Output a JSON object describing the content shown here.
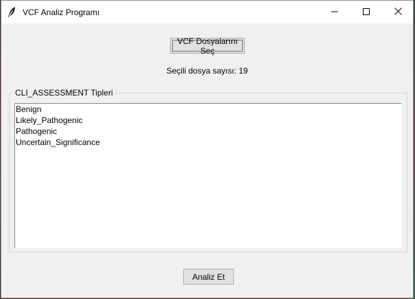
{
  "window": {
    "title": "VCF Analiz Programı",
    "icon": "feather-icon",
    "controls": {
      "minimize_icon": "minimize-icon",
      "maximize_icon": "maximize-icon",
      "close_icon": "close-icon"
    }
  },
  "file_select": {
    "button_label": "VCF Dosyalarını Seç",
    "count_label": "Seçili dosya sayısı: 19"
  },
  "assessment_group": {
    "title": "CLI_ASSESSMENT Tipleri",
    "items": [
      "Benign",
      "Likely_Pathogenic",
      "Pathogenic",
      "Uncertain_Significance"
    ]
  },
  "actions": {
    "analyze_label": "Analiz Et"
  }
}
